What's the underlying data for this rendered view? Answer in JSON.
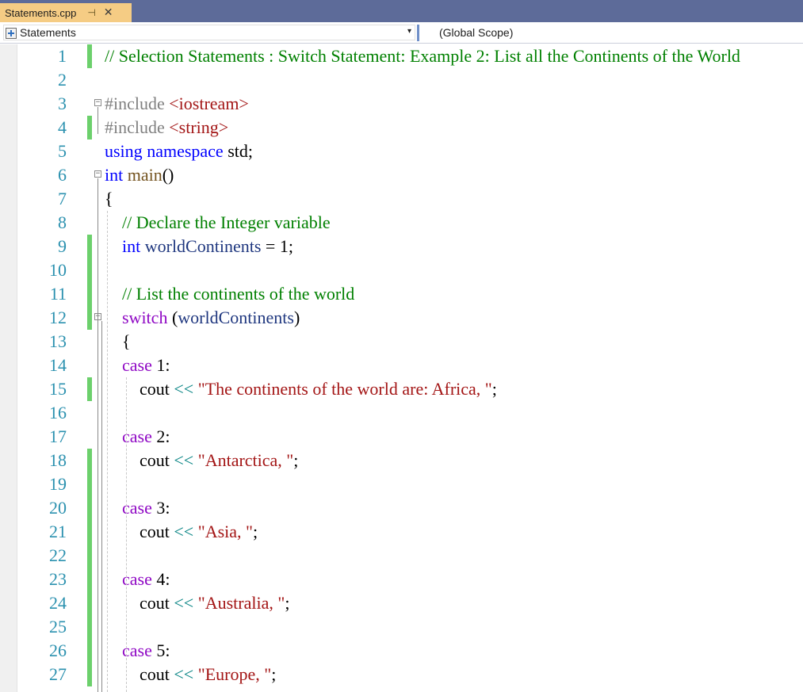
{
  "tab": {
    "filename": "Statements.cpp",
    "pin_glyph": "⊣",
    "close_glyph": "✕"
  },
  "navbar": {
    "left_scope": "Statements",
    "right_scope": "(Global Scope)",
    "dropdown_glyph": "▾"
  },
  "colors": {
    "tab_active": "#f5cc84",
    "tabstrip": "#5d6b99",
    "change_bar": "#6cd06c",
    "line_number": "#2b91af",
    "keyword": "#0000ff",
    "control": "#8f08c4",
    "comment": "#008000",
    "string": "#a31515",
    "preprocessor": "#808080"
  },
  "lines": [
    {
      "n": "1",
      "changed": true,
      "tokens": [
        {
          "c": "cm",
          "t": "// Selection Statements : Switch Statement: Example 2: List all the Continents of the World"
        }
      ]
    },
    {
      "n": "2",
      "changed": false,
      "tokens": []
    },
    {
      "n": "3",
      "changed": false,
      "fold": "−",
      "tokens": [
        {
          "c": "pp",
          "t": "#include "
        },
        {
          "c": "str",
          "t": "<iostream>"
        }
      ]
    },
    {
      "n": "4",
      "changed": true,
      "tokens": [
        {
          "c": "pp",
          "t": "#include "
        },
        {
          "c": "str",
          "t": "<string>"
        }
      ]
    },
    {
      "n": "5",
      "changed": false,
      "tokens": [
        {
          "c": "kw",
          "t": "using"
        },
        {
          "c": "",
          "t": " "
        },
        {
          "c": "kw",
          "t": "namespace"
        },
        {
          "c": "",
          "t": " std;"
        }
      ]
    },
    {
      "n": "6",
      "changed": false,
      "fold": "−",
      "tokens": [
        {
          "c": "kw",
          "t": "int"
        },
        {
          "c": "",
          "t": " "
        },
        {
          "c": "fn",
          "t": "main"
        },
        {
          "c": "",
          "t": "()"
        }
      ]
    },
    {
      "n": "7",
      "changed": false,
      "tokens": [
        {
          "c": "",
          "t": "{"
        }
      ]
    },
    {
      "n": "8",
      "changed": false,
      "tokens": [
        {
          "c": "",
          "t": "    "
        },
        {
          "c": "cm",
          "t": "// Declare the Integer variable"
        }
      ]
    },
    {
      "n": "9",
      "changed": true,
      "tokens": [
        {
          "c": "",
          "t": "    "
        },
        {
          "c": "kw",
          "t": "int"
        },
        {
          "c": "",
          "t": " "
        },
        {
          "c": "var",
          "t": "worldContinents"
        },
        {
          "c": "",
          "t": " = 1;"
        }
      ]
    },
    {
      "n": "10",
      "changed": true,
      "tokens": []
    },
    {
      "n": "11",
      "changed": true,
      "tokens": [
        {
          "c": "",
          "t": "    "
        },
        {
          "c": "cm",
          "t": "// List the continents of the world"
        }
      ]
    },
    {
      "n": "12",
      "changed": true,
      "fold": "−",
      "tokens": [
        {
          "c": "",
          "t": "    "
        },
        {
          "c": "ctl",
          "t": "switch"
        },
        {
          "c": "",
          "t": " ("
        },
        {
          "c": "var",
          "t": "worldContinents"
        },
        {
          "c": "",
          "t": ")"
        }
      ]
    },
    {
      "n": "13",
      "changed": false,
      "tokens": [
        {
          "c": "",
          "t": "    {"
        }
      ]
    },
    {
      "n": "14",
      "changed": false,
      "tokens": [
        {
          "c": "",
          "t": "    "
        },
        {
          "c": "ctl",
          "t": "case"
        },
        {
          "c": "",
          "t": " 1:"
        }
      ]
    },
    {
      "n": "15",
      "changed": true,
      "tokens": [
        {
          "c": "",
          "t": "        cout "
        },
        {
          "c": "op",
          "t": "<<"
        },
        {
          "c": "",
          "t": " "
        },
        {
          "c": "str",
          "t": "\"The continents of the world are: Africa, \""
        },
        {
          "c": "",
          "t": ";"
        }
      ]
    },
    {
      "n": "16",
      "changed": false,
      "tokens": []
    },
    {
      "n": "17",
      "changed": false,
      "tokens": [
        {
          "c": "",
          "t": "    "
        },
        {
          "c": "ctl",
          "t": "case"
        },
        {
          "c": "",
          "t": " 2:"
        }
      ]
    },
    {
      "n": "18",
      "changed": true,
      "tokens": [
        {
          "c": "",
          "t": "        cout "
        },
        {
          "c": "op",
          "t": "<<"
        },
        {
          "c": "",
          "t": " "
        },
        {
          "c": "str",
          "t": "\"Antarctica, \""
        },
        {
          "c": "",
          "t": ";"
        }
      ]
    },
    {
      "n": "19",
      "changed": true,
      "tokens": []
    },
    {
      "n": "20",
      "changed": true,
      "tokens": [
        {
          "c": "",
          "t": "    "
        },
        {
          "c": "ctl",
          "t": "case"
        },
        {
          "c": "",
          "t": " 3:"
        }
      ]
    },
    {
      "n": "21",
      "changed": true,
      "tokens": [
        {
          "c": "",
          "t": "        cout "
        },
        {
          "c": "op",
          "t": "<<"
        },
        {
          "c": "",
          "t": " "
        },
        {
          "c": "str",
          "t": "\"Asia, \""
        },
        {
          "c": "",
          "t": ";"
        }
      ]
    },
    {
      "n": "22",
      "changed": true,
      "tokens": []
    },
    {
      "n": "23",
      "changed": true,
      "tokens": [
        {
          "c": "",
          "t": "    "
        },
        {
          "c": "ctl",
          "t": "case"
        },
        {
          "c": "",
          "t": " 4:"
        }
      ]
    },
    {
      "n": "24",
      "changed": true,
      "tokens": [
        {
          "c": "",
          "t": "        cout "
        },
        {
          "c": "op",
          "t": "<<"
        },
        {
          "c": "",
          "t": " "
        },
        {
          "c": "str",
          "t": "\"Australia, \""
        },
        {
          "c": "",
          "t": ";"
        }
      ]
    },
    {
      "n": "25",
      "changed": true,
      "tokens": []
    },
    {
      "n": "26",
      "changed": true,
      "tokens": [
        {
          "c": "",
          "t": "    "
        },
        {
          "c": "ctl",
          "t": "case"
        },
        {
          "c": "",
          "t": " 5:"
        }
      ]
    },
    {
      "n": "27",
      "changed": true,
      "tokens": [
        {
          "c": "",
          "t": "        cout "
        },
        {
          "c": "op",
          "t": "<<"
        },
        {
          "c": "",
          "t": " "
        },
        {
          "c": "str",
          "t": "\"Europe, \""
        },
        {
          "c": "",
          "t": ";"
        }
      ]
    }
  ]
}
